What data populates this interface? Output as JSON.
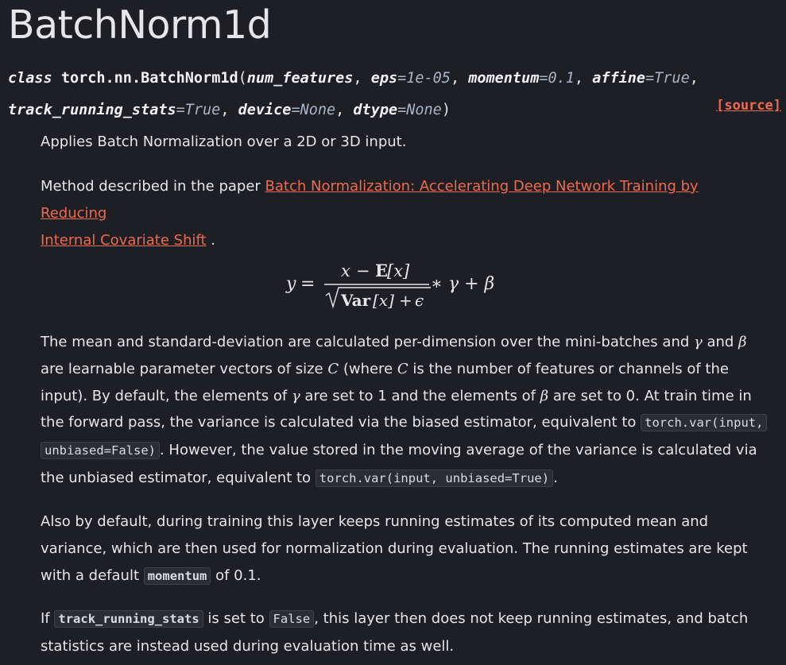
{
  "title": "BatchNorm1d",
  "signature": {
    "keyword": "class",
    "qualified_name": "torch.nn.BatchNorm1d",
    "open_paren": "(",
    "close_paren": ")",
    "params": [
      {
        "name": "num_features",
        "default": ""
      },
      {
        "name": "eps",
        "default": "1e-05"
      },
      {
        "name": "momentum",
        "default": "0.1"
      },
      {
        "name": "affine",
        "default": "True"
      },
      {
        "name": "track_running_stats",
        "default": "True"
      },
      {
        "name": "device",
        "default": "None"
      },
      {
        "name": "dtype",
        "default": "None"
      }
    ],
    "source_label": "[source]"
  },
  "paragraphs": {
    "p1": "Applies Batch Normalization over a 2D or 3D input.",
    "p2_prefix": "Method described in the paper ",
    "p2_link_line1": "Batch Normalization: Accelerating Deep Network Training by Reducing",
    "p2_link_line2": "Internal Covariate Shift",
    "p2_suffix": " .",
    "p3_a": "The mean and standard-deviation are calculated per-dimension over the mini-batches and ",
    "p3_gamma": "γ",
    "p3_b": " and ",
    "p3_beta": "β",
    "p3_c": " are learnable parameter vectors of size ",
    "p3_C1": "C",
    "p3_d": " (where ",
    "p3_C2": "C",
    "p3_e": " is the number of features or channels of the input). By default, the elements of ",
    "p3_gamma2": "γ",
    "p3_f": " are set to 1 and the elements of ",
    "p3_beta2": "β",
    "p3_g": " are set to 0. At train time in the forward pass, the variance is calculated via the biased estimator, equivalent to ",
    "p3_code1a": "torch.var(input,",
    "p3_code1b": "unbiased=False)",
    "p3_h": ". However, the value stored in the moving average of the variance is calculated via the unbiased estimator, equivalent to ",
    "p3_code2": "torch.var(input, unbiased=True)",
    "p3_i": ".",
    "p4_a": "Also by default, during training this layer keeps running estimates of its computed mean and variance, which are then used for normalization during evaluation. The running estimates are kept with a default ",
    "p4_code": "momentum",
    "p4_b": " of 0.1.",
    "p5_a": "If ",
    "p5_code1": "track_running_stats",
    "p5_b": " is set to ",
    "p5_code2": "False",
    "p5_c": ", this layer then does not keep running estimates, and batch statistics are instead used during evaluation time as well."
  },
  "formula": {
    "lhs": "y",
    "equals": "=",
    "num_x": "x",
    "minus": "−",
    "num_E": "E",
    "num_arg": "[x]",
    "den_var": "Var",
    "den_arg": "[x]",
    "den_plus": "+",
    "den_eps": "ϵ",
    "rhs": "∗ γ + β"
  },
  "colors": {
    "background": "#1e1f24",
    "text": "#e6e6e8",
    "link": "#ee6a4f",
    "param_default": "#a9b4c6",
    "code_bg": "#2b2d34"
  }
}
